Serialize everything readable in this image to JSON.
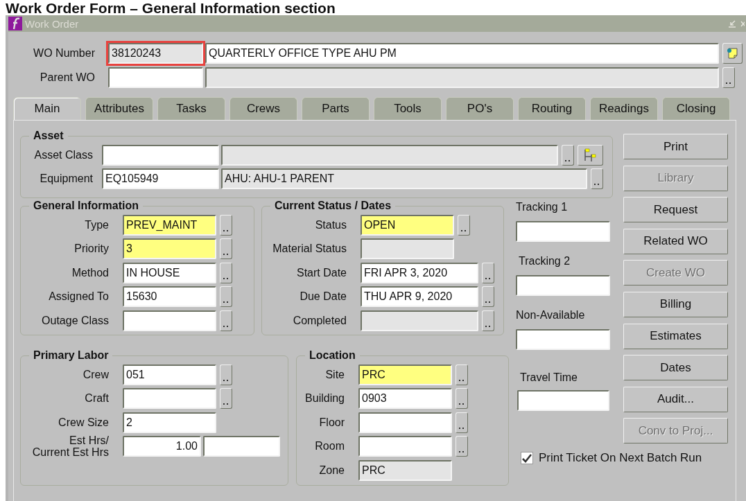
{
  "page_heading": "Work Order Form – General Information section",
  "window": {
    "title": "Work Order"
  },
  "header": {
    "rows": [
      {
        "label": "WO Number",
        "tool": {
          "kind": "notes"
        },
        "fields": [
          {
            "kind": "readonly",
            "value": "38120243",
            "highlighted": true,
            "lov": false
          },
          {
            "kind": "text",
            "value": "QUARTERLY OFFICE TYPE AHU PM",
            "lov": false
          }
        ]
      },
      {
        "label": "Parent WO",
        "fields": [
          {
            "kind": "text",
            "lov": false
          },
          {
            "kind": "readonly",
            "lov": true
          }
        ]
      }
    ]
  },
  "tabs": [
    {
      "label": "Main",
      "selected": true
    },
    {
      "label": "Attributes",
      "selected": false
    },
    {
      "label": "Tasks",
      "selected": false
    },
    {
      "label": "Crews",
      "selected": false
    },
    {
      "label": "Parts",
      "selected": false
    },
    {
      "label": "Tools",
      "selected": false
    },
    {
      "label": "PO's",
      "selected": false
    },
    {
      "label": "Routing",
      "selected": false
    },
    {
      "label": "Readings",
      "selected": false
    },
    {
      "label": "Closing",
      "selected": false
    }
  ],
  "asset": {
    "title": "Asset",
    "rows": [
      {
        "label": "Asset Class",
        "tool": {
          "kind": "hierarchy"
        },
        "fields": [
          {
            "kind": "text",
            "lov": false
          },
          {
            "kind": "readonly",
            "lov": true
          }
        ]
      },
      {
        "label": "Equipment",
        "fields": [
          {
            "kind": "text",
            "value": "EQ105949",
            "lov": false
          },
          {
            "kind": "readonly",
            "value": "AHU: AHU-1 PARENT",
            "lov": true
          }
        ]
      }
    ]
  },
  "general_information": {
    "title": "General Information",
    "rows": [
      {
        "label": "Type",
        "fields": [
          {
            "kind": "required",
            "value": "PREV_MAINT",
            "lov": true
          }
        ]
      },
      {
        "label": "Priority",
        "fields": [
          {
            "kind": "required",
            "value": "3",
            "lov": true
          }
        ]
      },
      {
        "label": "Method",
        "fields": [
          {
            "kind": "text",
            "value": "IN HOUSE",
            "lov": true
          }
        ]
      },
      {
        "label": "Assigned To",
        "fields": [
          {
            "kind": "text",
            "value": "15630",
            "lov": true
          }
        ]
      },
      {
        "label": "Outage Class",
        "fields": [
          {
            "kind": "text",
            "lov": true
          }
        ]
      }
    ]
  },
  "current_status": {
    "title": "Current Status / Dates",
    "rows": [
      {
        "label": "Status",
        "fields": [
          {
            "kind": "required",
            "value": "OPEN",
            "lov": true
          }
        ]
      },
      {
        "label": "Material Status",
        "fields": [
          {
            "kind": "readonly",
            "lov": false
          }
        ]
      },
      {
        "label": "Start Date",
        "fields": [
          {
            "kind": "text",
            "value": "FRI APR 3, 2020",
            "lov": true
          }
        ]
      },
      {
        "label": "Due Date",
        "fields": [
          {
            "kind": "text",
            "value": "THU APR 9, 2020",
            "lov": true
          }
        ]
      },
      {
        "label": "Completed",
        "fields": [
          {
            "kind": "readonly",
            "lov": true
          }
        ]
      }
    ]
  },
  "tracking": [
    {
      "label": "Tracking 1"
    },
    {
      "label": "Tracking 2"
    },
    {
      "label": "Non-Available"
    }
  ],
  "primary_labor": {
    "title": "Primary Labor",
    "rows": [
      {
        "label": "Crew",
        "fields": [
          {
            "kind": "text",
            "value": "051",
            "lov": true
          }
        ]
      },
      {
        "label": "Craft",
        "fields": [
          {
            "kind": "text",
            "lov": true
          }
        ]
      },
      {
        "label": "Crew Size",
        "fields": [
          {
            "kind": "text",
            "value": "2",
            "lov": false
          }
        ]
      },
      {
        "label": "Est Hrs/\nCurrent Est Hrs",
        "fields": [
          {
            "kind": "number",
            "value": "1.00",
            "lov": false
          },
          {
            "kind": "text",
            "lov": false
          }
        ]
      }
    ]
  },
  "location": {
    "title": "Location",
    "rows": [
      {
        "label": "Site",
        "fields": [
          {
            "kind": "required",
            "value": "PRC",
            "lov": true
          }
        ]
      },
      {
        "label": "Building",
        "fields": [
          {
            "kind": "text",
            "value": "0903",
            "lov": true
          }
        ]
      },
      {
        "label": "Floor",
        "fields": [
          {
            "kind": "text",
            "lov": true
          }
        ]
      },
      {
        "label": "Room",
        "fields": [
          {
            "kind": "text",
            "lov": true
          }
        ]
      },
      {
        "label": "Zone",
        "fields": [
          {
            "kind": "readonly",
            "value": "PRC",
            "lov": false
          }
        ]
      }
    ]
  },
  "travel_time": {
    "label": "Travel Time"
  },
  "print_ticket": {
    "label": "Print Ticket On Next Batch Run",
    "checked": true
  },
  "buttons": [
    {
      "label": "Print",
      "disabled": false
    },
    {
      "label": "Library",
      "disabled": true
    },
    {
      "label": "Request",
      "disabled": false
    },
    {
      "label": "Related WO",
      "disabled": false
    },
    {
      "label": "Create WO",
      "disabled": true
    },
    {
      "label": "Billing",
      "disabled": false
    },
    {
      "label": "Estimates",
      "disabled": false
    },
    {
      "label": "Dates",
      "disabled": false
    },
    {
      "label": "Audit...",
      "disabled": false
    },
    {
      "label": "Conv to Proj...",
      "disabled": true
    }
  ]
}
